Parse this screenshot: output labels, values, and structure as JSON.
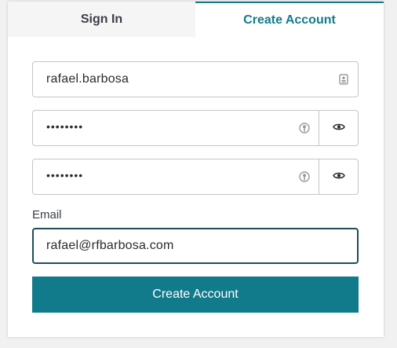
{
  "tabs": {
    "sign_in": "Sign In",
    "create_account": "Create Account",
    "active": "create_account"
  },
  "form": {
    "username_value": "rafael.barbosa",
    "username_icon": "contact-card-icon",
    "password_value": "••••••••",
    "password_icons": [
      "password-manager-key-icon",
      "eye-icon"
    ],
    "confirm_password_value": "••••••••",
    "email_label": "Email",
    "email_value": "rafael@rfbarbosa.com",
    "submit_label": "Create Account"
  },
  "colors": {
    "accent": "#127b8b",
    "focus_border": "#1f4d57",
    "inactive_tab_bg": "#f5f5f5"
  }
}
